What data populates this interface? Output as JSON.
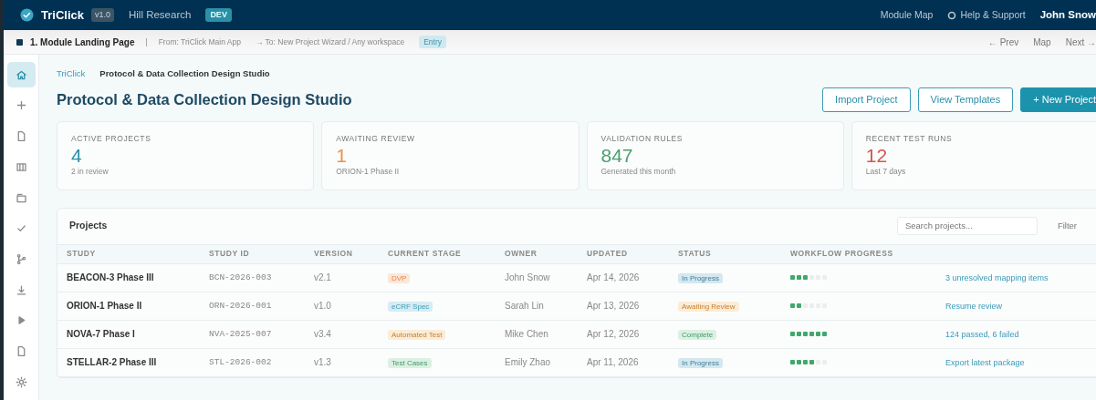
{
  "app_bar": {
    "brand": "TriClick",
    "version": "v1.0",
    "org": "Hill Research",
    "env": "DEV",
    "links": [
      "Module Map",
      "Help & Support"
    ],
    "user": "John Snow"
  },
  "step_bar": {
    "title": "1. Module Landing Page",
    "separator": "|",
    "from": "From: TriClick Main App",
    "to": "→ To: New Project Wizard / Any workspace",
    "tag": "Entry",
    "nav": [
      "← Prev",
      "Map",
      "Next →"
    ]
  },
  "sidebar": {
    "items": [
      {
        "selected": true
      },
      {
        "selected": false
      },
      {
        "selected": false
      },
      {
        "selected": false
      },
      {
        "selected": false
      },
      {
        "selected": false
      },
      {
        "selected": false
      },
      {
        "selected": false
      },
      {
        "selected": false
      },
      {
        "selected": false
      },
      {
        "selected": false
      }
    ]
  },
  "breadcrumb": [
    "TriClick",
    "Protocol & Data Collection Design Studio"
  ],
  "page_title": "Protocol & Data Collection Design Studio",
  "actions": [
    {
      "label": "Import Project",
      "kind": "outline"
    },
    {
      "label": "View Templates",
      "kind": "outline"
    },
    {
      "label": "+ New Project",
      "kind": "primary"
    }
  ],
  "stats": [
    {
      "label": "ACTIVE PROJECTS",
      "value": "4",
      "note": "2 in review",
      "color": "#2a8fa8"
    },
    {
      "label": "AWAITING REVIEW",
      "value": "1",
      "note": "ORION-1 Phase II",
      "color": "#e8944a"
    },
    {
      "label": "VALIDATION RULES",
      "value": "847",
      "note": "Generated this month",
      "color": "#4a9e6e"
    },
    {
      "label": "RECENT TEST RUNS",
      "value": "12",
      "note": "Last 7 days",
      "color": "#d0584a"
    }
  ],
  "projects": {
    "title": "Projects",
    "search": {
      "placeholder": "Search projects..."
    },
    "filter": "Filter",
    "columns": [
      "STUDY",
      "STUDY ID",
      "VERSION",
      "CURRENT STAGE",
      "OWNER",
      "UPDATED",
      "STATUS",
      "WORKFLOW PROGRESS"
    ],
    "rows": [
      {
        "study": "BEACON-3 Phase III",
        "id": "BCN-2026-003",
        "version": "v2.1",
        "stage": {
          "label": "DVP",
          "kind": "orange"
        },
        "owner": "John Snow",
        "updated": "Apr 14, 2026",
        "status": {
          "label": "In Progress",
          "kind": "blue"
        },
        "steps": [
          {
            "done": true
          },
          {
            "done": true
          },
          {
            "done": true
          },
          {
            "done": false
          },
          {
            "done": false
          },
          {
            "done": false
          }
        ],
        "action": "3 unresolved mapping items"
      },
      {
        "study": "ORION-1 Phase II",
        "id": "ORN-2026-001",
        "version": "v1.0",
        "stage": {
          "label": "eCRF Spec",
          "kind": "teal"
        },
        "owner": "Sarah Lin",
        "updated": "Apr 13, 2026",
        "status": {
          "label": "Awaiting Review",
          "kind": "amber"
        },
        "steps": [
          {
            "done": true
          },
          {
            "done": true
          },
          {
            "done": false
          },
          {
            "done": false
          },
          {
            "done": false
          },
          {
            "done": false
          }
        ],
        "action": "Resume review"
      },
      {
        "study": "NOVA-7 Phase I",
        "id": "NVA-2025-007",
        "version": "v3.4",
        "stage": {
          "label": "Automated Test",
          "kind": "amber"
        },
        "owner": "Mike Chen",
        "updated": "Apr 12, 2026",
        "status": {
          "label": "Complete",
          "kind": "green"
        },
        "steps": [
          {
            "done": true
          },
          {
            "done": true
          },
          {
            "done": true
          },
          {
            "done": true
          },
          {
            "done": true
          },
          {
            "done": true
          }
        ],
        "action": "124 passed, 6 failed"
      },
      {
        "study": "STELLAR-2 Phase III",
        "id": "STL-2026-002",
        "version": "v1.3",
        "stage": {
          "label": "Test Cases",
          "kind": "green"
        },
        "owner": "Emily Zhao",
        "updated": "Apr 11, 2026",
        "status": {
          "label": "In Progress",
          "kind": "blue"
        },
        "steps": [
          {
            "done": true
          },
          {
            "done": true
          },
          {
            "done": true
          },
          {
            "done": true
          },
          {
            "done": false
          },
          {
            "done": false
          }
        ],
        "action": "Export latest package"
      }
    ]
  }
}
